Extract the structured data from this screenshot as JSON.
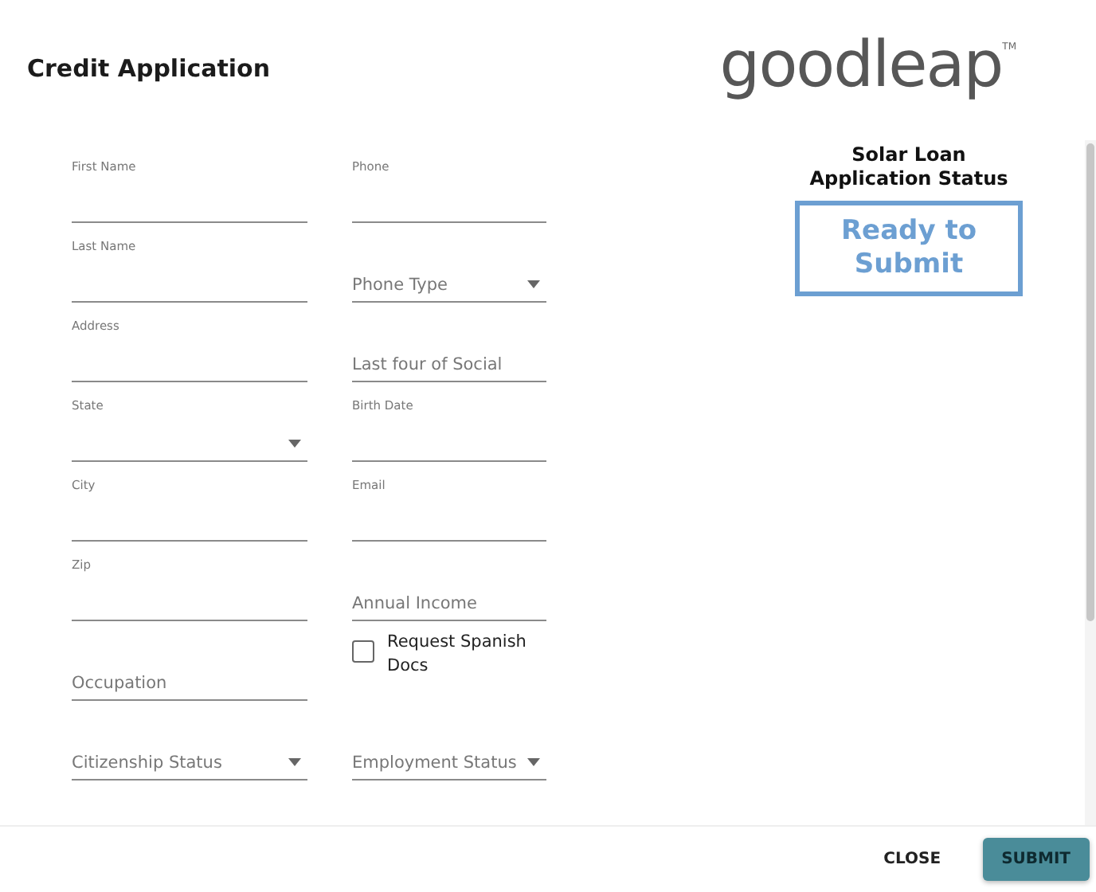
{
  "dialog": {
    "title": "Credit Application",
    "logo": {
      "text": "goodleap",
      "trademark": "TM"
    }
  },
  "status": {
    "heading": "Solar Loan Application Status",
    "value": "Ready to Submit"
  },
  "fields": [
    {
      "kind": "label",
      "label": "First Name"
    },
    {
      "kind": "label",
      "label": "Phone"
    },
    {
      "kind": "label",
      "label": "Last Name"
    },
    {
      "kind": "select",
      "placeholder": "Phone Type"
    },
    {
      "kind": "label",
      "label": "Address"
    },
    {
      "kind": "placeholder",
      "placeholder": "Last four of Social"
    },
    {
      "kind": "select-label",
      "label": "State"
    },
    {
      "kind": "label",
      "label": "Birth Date"
    },
    {
      "kind": "label",
      "label": "City"
    },
    {
      "kind": "label",
      "label": "Email"
    },
    {
      "kind": "label",
      "label": "Zip"
    },
    {
      "kind": "placeholder",
      "placeholder": "Annual Income"
    },
    {
      "kind": "placeholder",
      "placeholder": "Occupation"
    },
    {
      "kind": "checkbox",
      "label": "Request Spanish Docs",
      "checked": false
    },
    {
      "kind": "select",
      "placeholder": "Citizenship Status"
    },
    {
      "kind": "select",
      "placeholder": "Employment Status"
    }
  ],
  "buttons": [
    {
      "label": "CLOSE",
      "primary": false
    },
    {
      "label": "SUBMIT",
      "primary": true
    }
  ]
}
